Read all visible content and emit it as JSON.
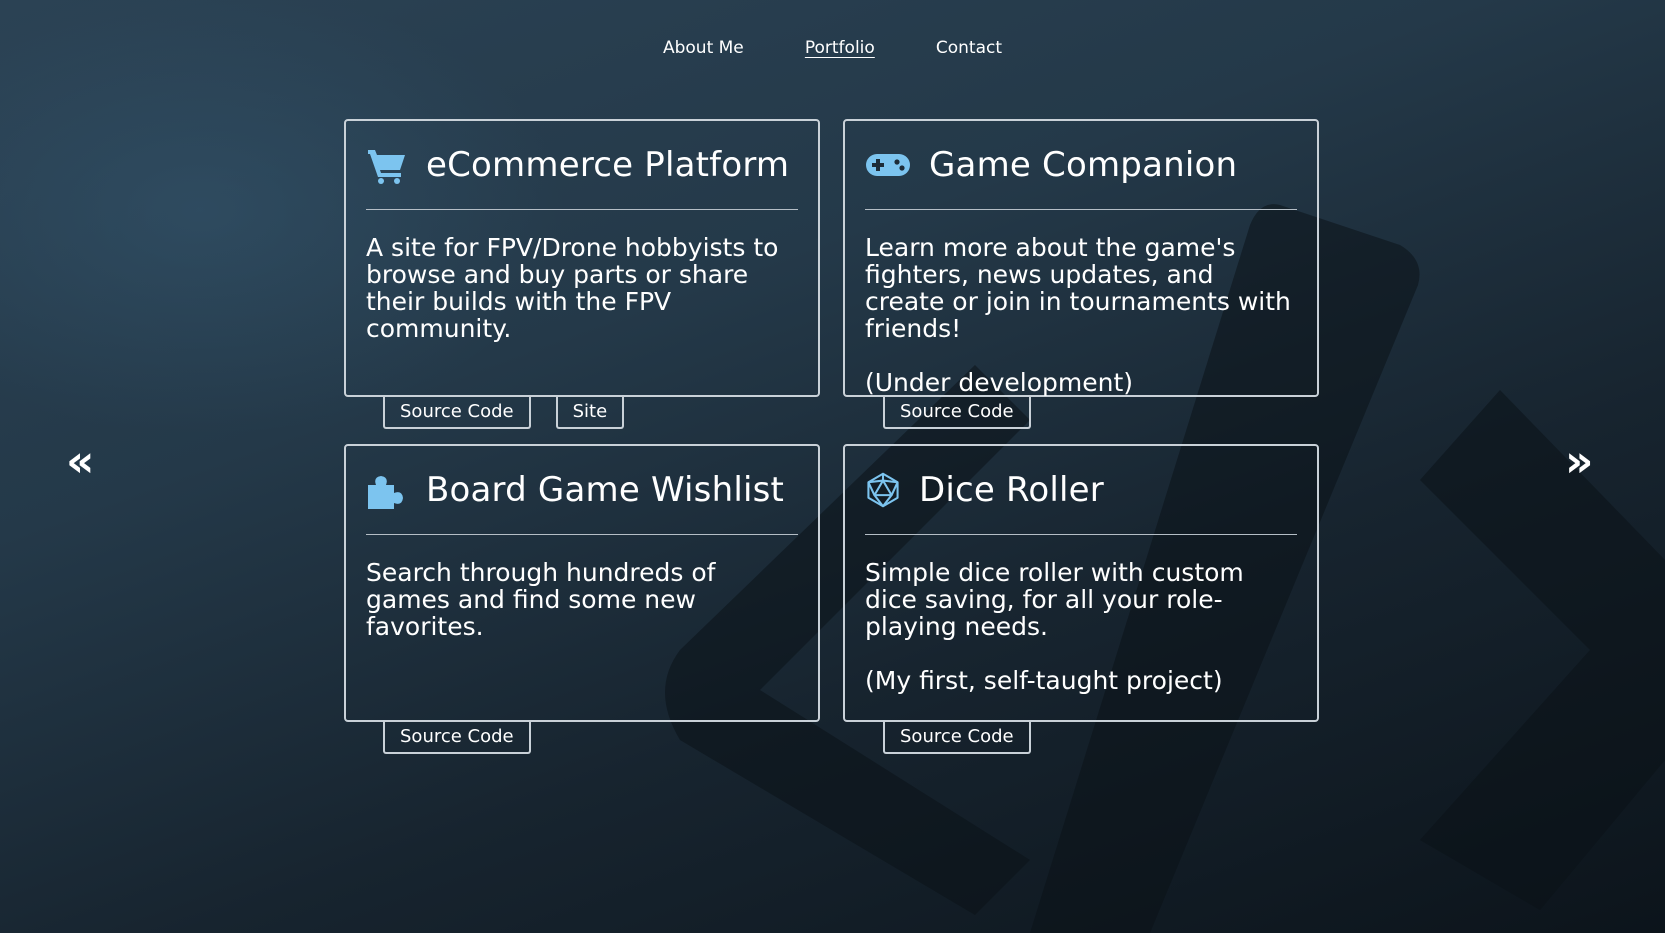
{
  "nav": {
    "items": [
      {
        "label": "About Me"
      },
      {
        "label": "Portfolio",
        "active": true
      },
      {
        "label": "Contact"
      }
    ]
  },
  "carousel": {
    "prev_label": "«",
    "next_label": "»"
  },
  "projects": [
    {
      "icon": "shopping-cart-icon",
      "title": "eCommerce Platform",
      "description": "A site for FPV/Drone hobbyists to browse and buy parts or share their builds with the FPV community.",
      "note": "",
      "buttons": [
        "Source Code",
        "Site"
      ]
    },
    {
      "icon": "gamepad-icon",
      "title": "Game Companion",
      "description": "Learn more about the game's fighters, news updates, and create or join in tournaments with friends!",
      "note": "(Under development)",
      "buttons": [
        "Source Code"
      ]
    },
    {
      "icon": "puzzle-piece-icon",
      "title": "Board Game Wishlist",
      "description": "Search through hundreds of games and find some new favorites.",
      "note": "",
      "buttons": [
        "Source Code"
      ]
    },
    {
      "icon": "d20-dice-icon",
      "title": "Dice Roller",
      "description": "Simple dice roller with custom dice saving, for all your role-playing needs.",
      "note": "(My first, self-taught project)",
      "buttons": [
        "Source Code"
      ]
    }
  ],
  "colors": {
    "accent_icon": "#7cc4ef",
    "border": "#c9d1d8"
  }
}
